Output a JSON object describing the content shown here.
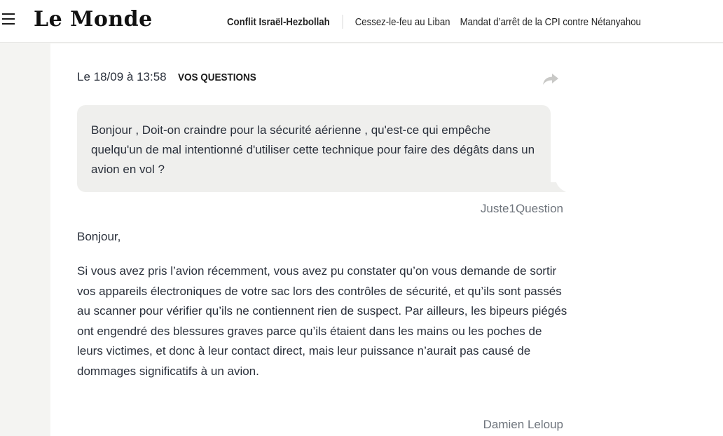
{
  "header": {
    "logo": "Le Monde",
    "nav": [
      "Conflit Israël-Hezbollah",
      "Cessez-le-feu au Liban",
      "Mandat d’arrêt de la CPI contre Nétanyahou"
    ]
  },
  "post": {
    "date": "Le 18/09 à 13:58",
    "label": "VOS QUESTIONS",
    "question": "Bonjour , Doit-on craindre pour la sécurité aérienne , qu'est-ce qui empêche quelqu'un de mal intentionné d'utiliser cette technique pour faire des dégâts dans un avion en vol ?",
    "question_author": "Juste1Question",
    "greeting": "Bonjour,",
    "answer": "Si vous avez pris l’avion récemment, vous avez pu constater qu’on vous demande de sortir vos appareils électroniques de votre sac lors des contrôles de sécurité, et qu’ils sont passés au scanner pour vérifier qu’ils ne contiennent rien de suspect. Par ailleurs, les bipeurs piégés ont engendré des blessures graves parce qu’ils étaient dans les mains ou les poches de leurs victimes, et donc à leur contact direct, mais leur puissance n’aurait pas causé de dommages significatifs à un avion.",
    "answer_author": "Damien Leloup"
  },
  "icons": {
    "menu": "hamburger-menu-icon",
    "share": "share-arrow-icon"
  },
  "colors": {
    "bubble": "#efefed",
    "page_bg": "#f4f4f2",
    "author": "#6e747c"
  }
}
